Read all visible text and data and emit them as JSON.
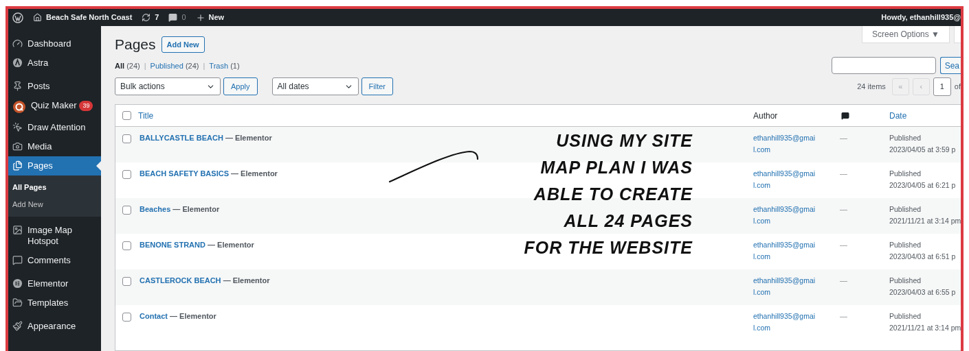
{
  "admin_bar": {
    "site": "Beach Safe North Coast",
    "updates": "7",
    "comments": "0",
    "new": "New",
    "greeting": "Howdy, ethanhill935@"
  },
  "sidebar": {
    "items": [
      {
        "label": "Dashboard",
        "selected": false
      },
      {
        "label": "Astra",
        "selected": false
      },
      {
        "label": "Posts",
        "selected": false
      },
      {
        "label": "Quiz Maker",
        "selected": false,
        "badge": "39"
      },
      {
        "label": "Draw Attention",
        "selected": false
      },
      {
        "label": "Media",
        "selected": false
      },
      {
        "label": "Pages",
        "selected": true,
        "children": [
          {
            "label": "All Pages",
            "selected": true
          },
          {
            "label": "Add New",
            "selected": false
          }
        ]
      },
      {
        "label": "Image Map Hotspot",
        "selected": false
      },
      {
        "label": "Comments",
        "selected": false
      },
      {
        "label": "Elementor",
        "selected": false
      },
      {
        "label": "Templates",
        "selected": false
      },
      {
        "label": "Appearance",
        "selected": false
      }
    ]
  },
  "header": {
    "title": "Pages",
    "add_new": "Add New",
    "screen_options": "Screen Options ▼"
  },
  "view_separator": "|",
  "select_all_checked": false,
  "views": [
    {
      "label": "All",
      "count": "(24)",
      "selected": true
    },
    {
      "label": "Published",
      "count": "(24)",
      "selected": false
    },
    {
      "label": "Trash",
      "count": "(1)",
      "selected": false
    }
  ],
  "filters": {
    "bulk_actions": "Bulk actions",
    "apply": "Apply",
    "dates": "All dates",
    "filter": "Filter"
  },
  "search": {
    "button": "Sea"
  },
  "pagination": {
    "items": "24 items",
    "first": "«",
    "prev": "‹",
    "page": "1",
    "of": "of"
  },
  "table": {
    "columns": [
      "Title",
      "Author",
      "Date"
    ],
    "rows": [
      {
        "checked": false,
        "title": "BALLYCASTLE BEACH",
        "suffix": "— Elementor",
        "author": [
          "ethanhill935@gmai",
          "l.com"
        ],
        "comments": "—",
        "status": "Published",
        "date": "2023/04/05 at 3:59 p"
      },
      {
        "checked": false,
        "title": "BEACH SAFETY BASICS",
        "suffix": "— Elementor",
        "author": [
          "ethanhill935@gmai",
          "l.com"
        ],
        "comments": "—",
        "status": "Published",
        "date": "2023/04/05 at 6:21 p"
      },
      {
        "checked": false,
        "title": "Beaches",
        "suffix": "— Elementor",
        "author": [
          "ethanhill935@gmai",
          "l.com"
        ],
        "comments": "—",
        "status": "Published",
        "date": "2021/11/21 at 3:14 pm"
      },
      {
        "checked": false,
        "title": "BENONE STRAND",
        "suffix": "— Elementor",
        "author": [
          "ethanhill935@gmai",
          "l.com"
        ],
        "comments": "—",
        "status": "Published",
        "date": "2023/04/03 at 6:51 p"
      },
      {
        "checked": false,
        "title": "CASTLEROCK BEACH",
        "suffix": "— Elementor",
        "author": [
          "ethanhill935@gmai",
          "l.com"
        ],
        "comments": "—",
        "status": "Published",
        "date": "2023/04/03 at 6:55 p"
      },
      {
        "checked": false,
        "title": "Contact",
        "suffix": "— Elementor",
        "author": [
          "ethanhill935@gmai",
          "l.com"
        ],
        "comments": "—",
        "status": "Published",
        "date": "2021/11/21 at 3:14 pm"
      }
    ]
  },
  "annotation": {
    "lines": [
      "USING MY SITE",
      "MAP PLAN I WAS",
      "ABLE TO CREATE",
      "ALL 24 PAGES",
      "FOR THE WEBSITE"
    ]
  }
}
